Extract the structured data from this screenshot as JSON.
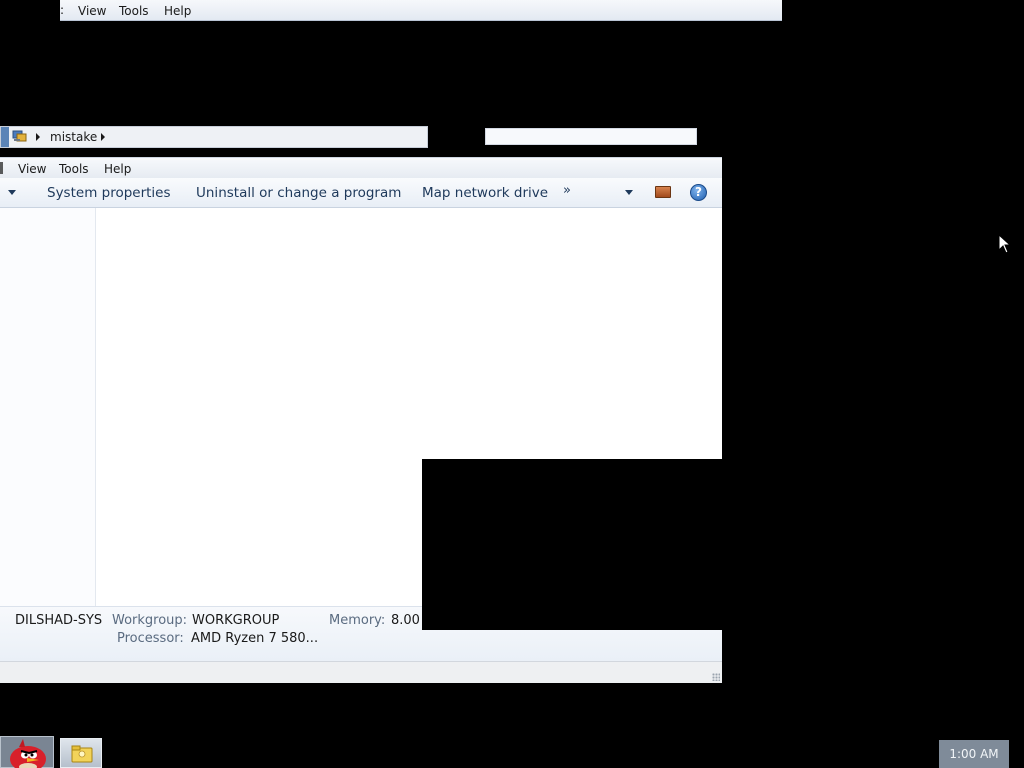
{
  "top_menubar": {
    "items": [
      "View",
      "Tools",
      "Help"
    ]
  },
  "address_bar": {
    "crumb": "mistake"
  },
  "main_menubar": {
    "items": [
      "View",
      "Tools",
      "Help"
    ]
  },
  "toolbar": {
    "system_properties": "System properties",
    "uninstall": "Uninstall or change a program",
    "map_drive": "Map network drive",
    "more": "»"
  },
  "details": {
    "computer_name": "DILSHAD-SYS",
    "workgroup_label": "Workgroup:",
    "workgroup_value": "WORKGROUP",
    "memory_label": "Memory:",
    "memory_value": "8.00",
    "processor_label": "Processor:",
    "processor_value": "AMD Ryzen 7 580..."
  },
  "taskbar": {
    "clock": "1:00 AM"
  },
  "colors": {
    "toolbar_text": "#1e395b",
    "label_gray": "#5a6b80",
    "help_blue": "#1f5fb0"
  },
  "icons": [
    "computer-icon",
    "orange-preview-icon",
    "help-icon",
    "angry-bird-icon",
    "folder-icon",
    "mouse-cursor"
  ]
}
